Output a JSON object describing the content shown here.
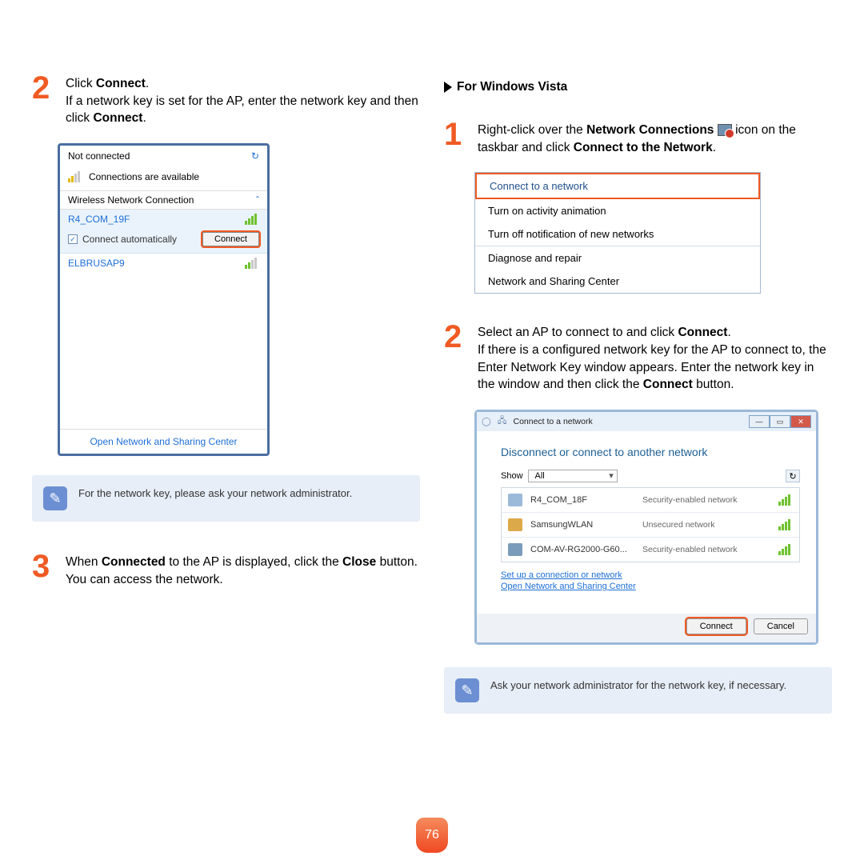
{
  "page_number": "76",
  "left": {
    "step2_a": "Click ",
    "step2_b": "Connect",
    "step2_c": ".",
    "step2_line2_a": "If a network key is set for the AP, enter the network key and then click ",
    "step2_line2_b": "Connect",
    "step2_line2_c": ".",
    "win7": {
      "not_connected": "Not connected",
      "available": "Connections are available",
      "section": "Wireless Network Connection",
      "net1": "R4_COM_19F",
      "auto": "Connect automatically",
      "connect_btn": "Connect",
      "net2": "ELBRUSAP9",
      "open_center": "Open Network and Sharing Center"
    },
    "note": "For the network key, please ask your network administrator.",
    "step3_a": "When ",
    "step3_b": "Connected",
    "step3_c": " to the AP is displayed, click the ",
    "step3_d": "Close",
    "step3_e": " button.",
    "step3_line2": "You can access the network."
  },
  "right": {
    "heading": "For Windows Vista",
    "step1_a": "Right-click over the ",
    "step1_b": "Network Connections",
    "step1_c": " icon on the taskbar and click ",
    "step1_d": "Connect to the Network",
    "step1_e": ".",
    "menu": {
      "i1": "Connect to a network",
      "i2": "Turn on activity animation",
      "i3": "Turn off notification of new networks",
      "i4": "Diagnose and repair",
      "i5": "Network and Sharing Center"
    },
    "step2_a": "Select an AP to connect to and click ",
    "step2_b": "Connect",
    "step2_c": ".",
    "step2_p_a": "If there is a configured network key for the AP to connect to, the Enter Network Key window appears. Enter the network key in the window and then click the ",
    "step2_p_b": "Connect",
    "step2_p_c": " button.",
    "vista_win": {
      "title": "Connect to a network",
      "heading": "Disconnect or connect to another network",
      "show": "Show",
      "show_val": "All",
      "n1": "R4_COM_18F",
      "n1s": "Security-enabled network",
      "n2": "SamsungWLAN",
      "n2s": "Unsecured network",
      "n3": "COM-AV-RG2000-G60...",
      "n3s": "Security-enabled network",
      "link1": "Set up a connection or network",
      "link2": "Open Network and Sharing Center",
      "connect": "Connect",
      "cancel": "Cancel"
    },
    "note": "Ask your network administrator for the network key, if necessary."
  }
}
